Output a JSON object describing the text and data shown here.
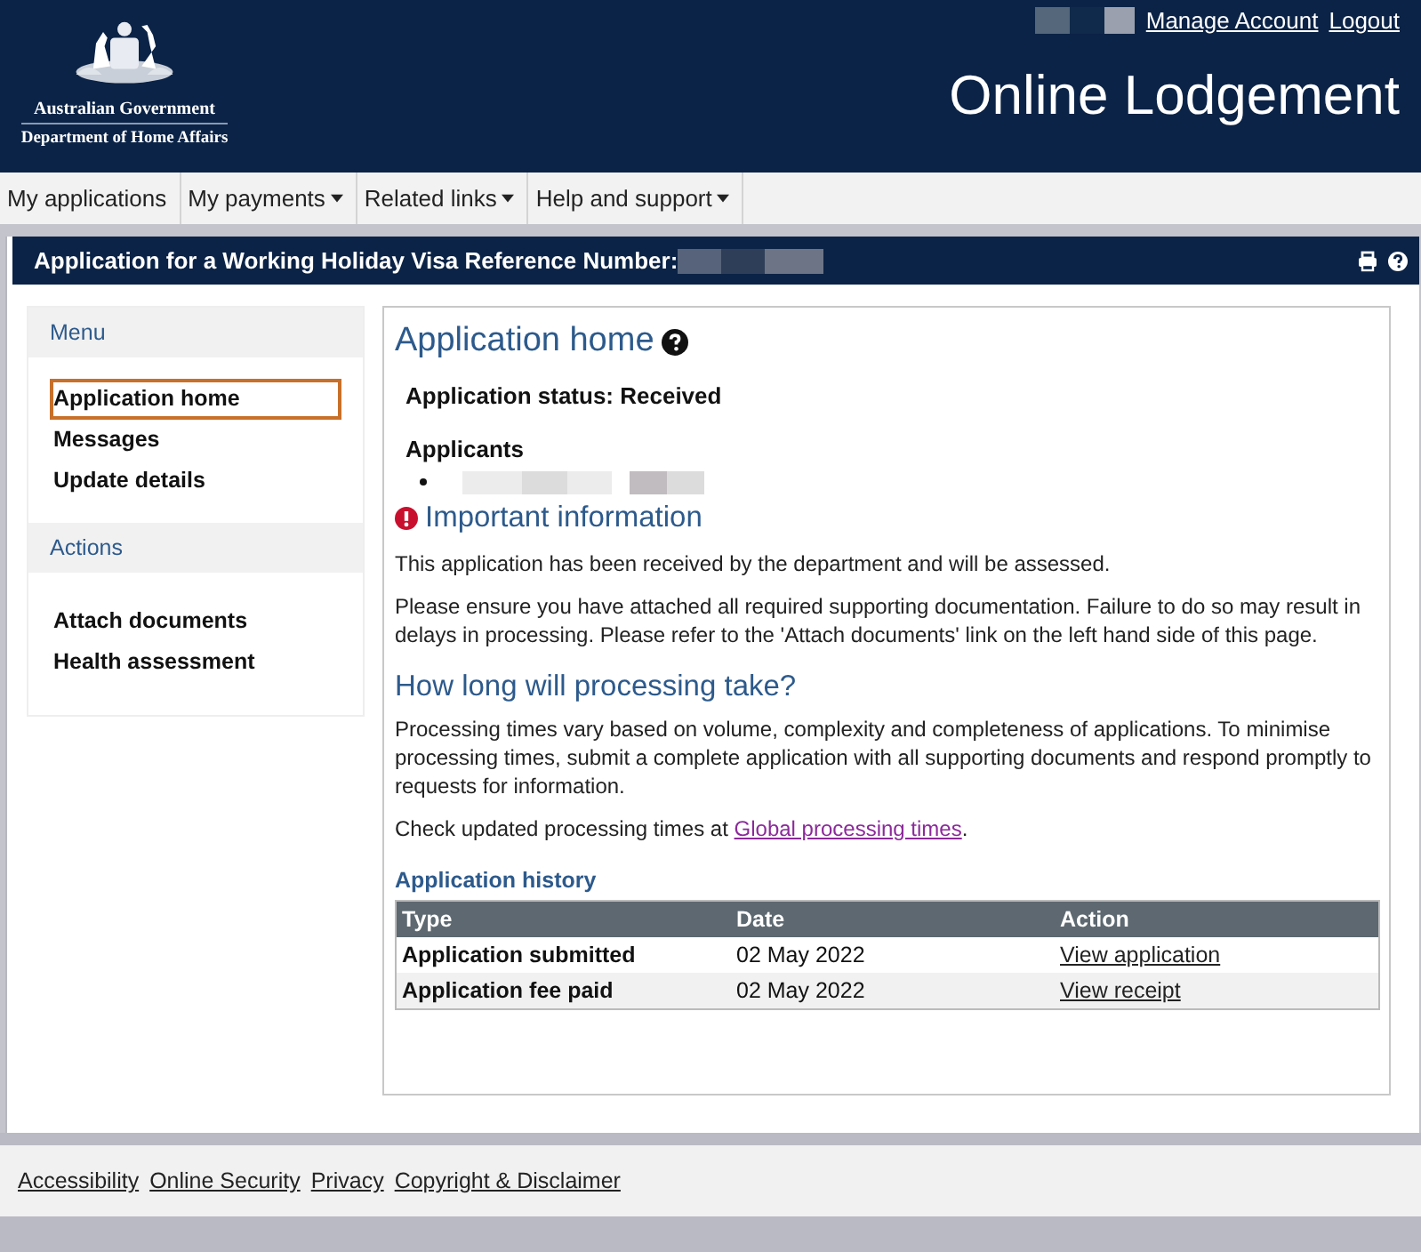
{
  "header": {
    "agency_lines": [
      "Australian Government",
      "Department of Home Affairs"
    ],
    "account_links": [
      "Manage Account",
      "Logout"
    ],
    "title": "Online Lodgement"
  },
  "nav": [
    {
      "label": "My applications",
      "dropdown": false
    },
    {
      "label": "My payments",
      "dropdown": true
    },
    {
      "label": "Related links",
      "dropdown": true
    },
    {
      "label": "Help and support",
      "dropdown": true
    }
  ],
  "app_bar": {
    "title": "Application for a Working Holiday Visa Reference Number:"
  },
  "sidebar": [
    {
      "heading": "Menu",
      "items": [
        {
          "label": "Application home",
          "selected": true
        },
        {
          "label": "Messages",
          "selected": false
        },
        {
          "label": "Update details",
          "selected": false
        }
      ]
    },
    {
      "heading": "Actions",
      "items": [
        {
          "label": "Attach documents",
          "selected": false
        },
        {
          "label": "Health assessment",
          "selected": false
        }
      ]
    }
  ],
  "content": {
    "heading": "Application home",
    "status": "Application status: Received",
    "applicants_heading": "Applicants",
    "important": {
      "heading": "Important information",
      "paragraphs": [
        "This application has been received by the department and will be assessed.",
        "Please ensure you have attached all required supporting documentation. Failure to do so may result in delays in processing. Please refer to the 'Attach documents' link on the left hand side of this page."
      ]
    },
    "processing": {
      "heading": "How long will processing take?",
      "paragraph": "Processing times vary based on volume, complexity and completeness of applications. To minimise processing times, submit a complete application with all supporting documents and respond promptly to requests for information.",
      "check": {
        "before": "Check updated processing times at ",
        "link": "Global processing times",
        "after": "."
      }
    },
    "history": {
      "heading": "Application history",
      "columns": [
        "Type",
        "Date",
        "Action"
      ],
      "rows": [
        {
          "type": "Application submitted",
          "date": "02 May 2022",
          "action": "View application"
        },
        {
          "type": "Application fee paid",
          "date": "02 May 2022",
          "action": "View receipt"
        }
      ]
    }
  },
  "footer": [
    "Accessibility",
    "Online Security",
    "Privacy",
    "Copyright & Disclaimer"
  ]
}
